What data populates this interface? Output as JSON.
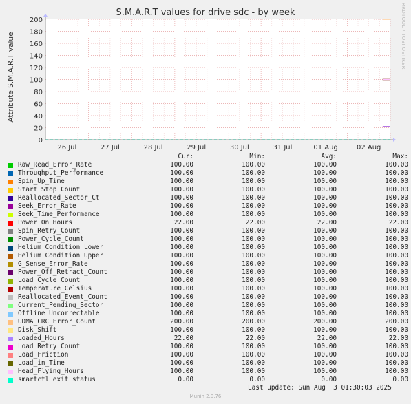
{
  "chart_data": {
    "type": "line",
    "title": "S.M.A.R.T values for drive sdc - by week",
    "ylabel": "Attribute S.M.A.R.T value",
    "xlabel": "",
    "ylim": [
      0,
      200
    ],
    "yticks": [
      "0",
      "20",
      "40",
      "60",
      "80",
      "100",
      "120",
      "140",
      "160",
      "180",
      "200"
    ],
    "xticks": [
      "26 Jul",
      "27 Jul",
      "28 Jul",
      "29 Jul",
      "30 Jul",
      "31 Jul",
      "01 Aug",
      "02 Aug"
    ],
    "data_start_day_fraction": 0.823,
    "columns": [
      "Cur:",
      "Min:",
      "Avg:",
      "Max:"
    ],
    "series": [
      {
        "name": "Raw_Read_Error_Rate",
        "color": "#00cc00",
        "cur": "100.00",
        "min": "100.00",
        "avg": "100.00",
        "max": "100.00",
        "value": 100
      },
      {
        "name": "Throughput_Performance",
        "color": "#0066b3",
        "cur": "100.00",
        "min": "100.00",
        "avg": "100.00",
        "max": "100.00",
        "value": 100
      },
      {
        "name": "Spin_Up_Time",
        "color": "#ff8000",
        "cur": "100.00",
        "min": "100.00",
        "avg": "100.00",
        "max": "100.00",
        "value": 100
      },
      {
        "name": "Start_Stop_Count",
        "color": "#ffcc00",
        "cur": "100.00",
        "min": "100.00",
        "avg": "100.00",
        "max": "100.00",
        "value": 100
      },
      {
        "name": "Reallocated_Sector_Ct",
        "color": "#330099",
        "cur": "100.00",
        "min": "100.00",
        "avg": "100.00",
        "max": "100.00",
        "value": 100
      },
      {
        "name": "Seek_Error_Rate",
        "color": "#990099",
        "cur": "100.00",
        "min": "100.00",
        "avg": "100.00",
        "max": "100.00",
        "value": 100
      },
      {
        "name": "Seek_Time_Performance",
        "color": "#ccff00",
        "cur": "100.00",
        "min": "100.00",
        "avg": "100.00",
        "max": "100.00",
        "value": 100
      },
      {
        "name": "Power_On_Hours",
        "color": "#ff0000",
        "cur": "22.00",
        "min": "22.00",
        "avg": "22.00",
        "max": "22.00",
        "value": 22
      },
      {
        "name": "Spin_Retry_Count",
        "color": "#808080",
        "cur": "100.00",
        "min": "100.00",
        "avg": "100.00",
        "max": "100.00",
        "value": 100
      },
      {
        "name": "Power_Cycle_Count",
        "color": "#008f00",
        "cur": "100.00",
        "min": "100.00",
        "avg": "100.00",
        "max": "100.00",
        "value": 100
      },
      {
        "name": "Helium_Condition_Lower",
        "color": "#00487d",
        "cur": "100.00",
        "min": "100.00",
        "avg": "100.00",
        "max": "100.00",
        "value": 100
      },
      {
        "name": "Helium_Condition_Upper",
        "color": "#b35a00",
        "cur": "100.00",
        "min": "100.00",
        "avg": "100.00",
        "max": "100.00",
        "value": 100
      },
      {
        "name": "G_Sense_Error_Rate",
        "color": "#b38f00",
        "cur": "100.00",
        "min": "100.00",
        "avg": "100.00",
        "max": "100.00",
        "value": 100
      },
      {
        "name": "Power_Off_Retract_Count",
        "color": "#6b006b",
        "cur": "100.00",
        "min": "100.00",
        "avg": "100.00",
        "max": "100.00",
        "value": 100
      },
      {
        "name": "Load_Cycle_Count",
        "color": "#8fb300",
        "cur": "100.00",
        "min": "100.00",
        "avg": "100.00",
        "max": "100.00",
        "value": 100
      },
      {
        "name": "Temperature_Celsius",
        "color": "#b30000",
        "cur": "100.00",
        "min": "100.00",
        "avg": "100.00",
        "max": "100.00",
        "value": 100
      },
      {
        "name": "Reallocated_Event_Count",
        "color": "#bebebe",
        "cur": "100.00",
        "min": "100.00",
        "avg": "100.00",
        "max": "100.00",
        "value": 100
      },
      {
        "name": "Current_Pending_Sector",
        "color": "#80ff80",
        "cur": "100.00",
        "min": "100.00",
        "avg": "100.00",
        "max": "100.00",
        "value": 100
      },
      {
        "name": "Offline_Uncorrectable",
        "color": "#80c9ff",
        "cur": "100.00",
        "min": "100.00",
        "avg": "100.00",
        "max": "100.00",
        "value": 100
      },
      {
        "name": "UDMA_CRC_Error_Count",
        "color": "#ffc080",
        "cur": "200.00",
        "min": "200.00",
        "avg": "200.00",
        "max": "200.00",
        "value": 200
      },
      {
        "name": "Disk_Shift",
        "color": "#ffe680",
        "cur": "100.00",
        "min": "100.00",
        "avg": "100.00",
        "max": "100.00",
        "value": 100
      },
      {
        "name": "Loaded_Hours",
        "color": "#aa80ff",
        "cur": "22.00",
        "min": "22.00",
        "avg": "22.00",
        "max": "22.00",
        "value": 22
      },
      {
        "name": "Load_Retry_Count",
        "color": "#ee00cc",
        "cur": "100.00",
        "min": "100.00",
        "avg": "100.00",
        "max": "100.00",
        "value": 100
      },
      {
        "name": "Load_Friction",
        "color": "#ff8080",
        "cur": "100.00",
        "min": "100.00",
        "avg": "100.00",
        "max": "100.00",
        "value": 100
      },
      {
        "name": "Load_in_Time",
        "color": "#666600",
        "cur": "100.00",
        "min": "100.00",
        "avg": "100.00",
        "max": "100.00",
        "value": 100
      },
      {
        "name": "Head_Flying_Hours",
        "color": "#ffbfff",
        "cur": "100.00",
        "min": "100.00",
        "avg": "100.00",
        "max": "100.00",
        "value": 100
      },
      {
        "name": "smartctl_exit_status",
        "color": "#00ffcc",
        "cur": "0.00",
        "min": "0.00",
        "avg": "0.00",
        "max": "0.00",
        "value": 0
      }
    ]
  },
  "last_update": "Last update: Sun Aug  3 01:30:03 2025",
  "credit": "Munin 2.0.76",
  "side_label": "RRDTOOL / TOBI OETIKER"
}
